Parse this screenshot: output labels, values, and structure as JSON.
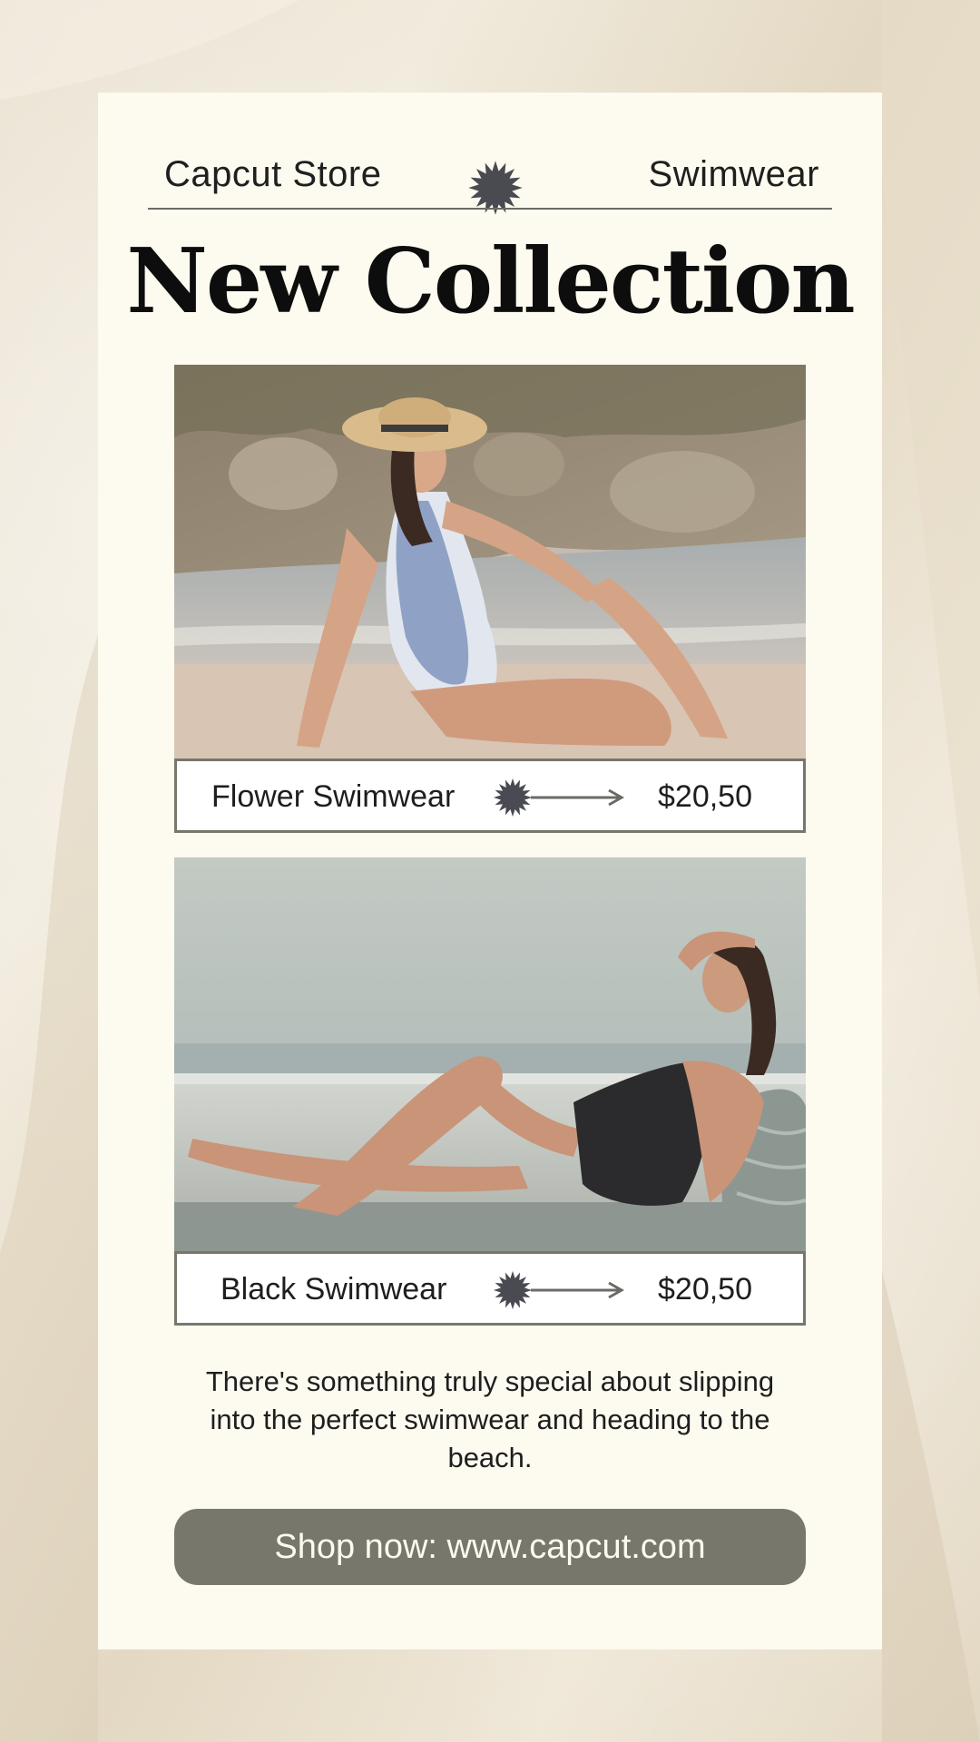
{
  "header": {
    "store_name": "Capcut Store",
    "category": "Swimwear"
  },
  "title": "New Collection",
  "products": [
    {
      "name": "Flower Swimwear",
      "price": "$20,50"
    },
    {
      "name": "Black Swimwear",
      "price": "$20,50"
    }
  ],
  "description": "There's something truly special about slipping into the perfect swimwear and heading to the beach.",
  "cta": {
    "label": "Shop now: www.capcut.com"
  },
  "icons": {
    "header": "star-burst-icon",
    "product_bar": [
      "star-burst-icon",
      "arrow-right-icon"
    ]
  },
  "colors": {
    "card_background": "#fdfaef",
    "accent": "#77776b",
    "star": "#4a4a52",
    "text": "#1e1e1e"
  }
}
